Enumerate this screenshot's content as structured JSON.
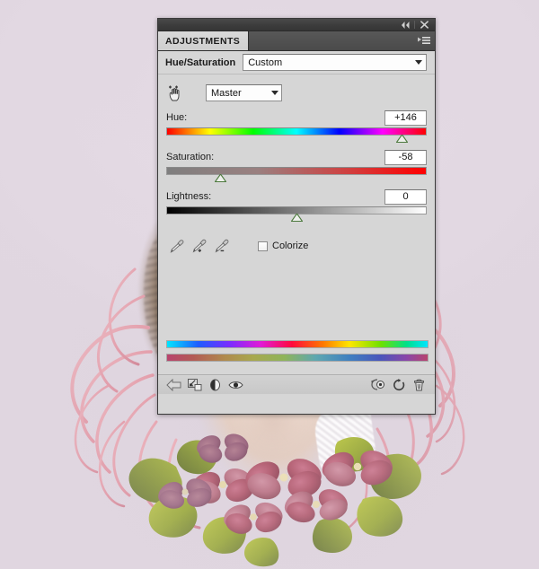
{
  "window": {
    "collapse_icon": "collapse-double-chevron-icon",
    "close_icon": "close-x-icon"
  },
  "panel": {
    "tab_label": "ADJUSTMENTS",
    "flyout_icon": "panel-menu-icon",
    "adjustment_name": "Hue/Saturation",
    "preset": {
      "value": "Custom",
      "dropdown_icon": "chevron-down-icon"
    },
    "target_tool_icon": "on-image-adjustment-hand-icon",
    "channel": {
      "value": "Master",
      "dropdown_icon": "chevron-down-icon"
    },
    "sliders": [
      {
        "name": "hue",
        "label": "Hue:",
        "value": "+146",
        "numeric": 146,
        "min": -180,
        "max": 180,
        "thumb_percent": 90.6
      },
      {
        "name": "saturation",
        "label": "Saturation:",
        "value": "-58",
        "numeric": -58,
        "min": -100,
        "max": 100,
        "thumb_percent": 21.0
      },
      {
        "name": "lightness",
        "label": "Lightness:",
        "value": "0",
        "numeric": 0,
        "min": -100,
        "max": 100,
        "thumb_percent": 50.0
      }
    ],
    "eyedroppers": [
      {
        "name": "sample-color-eyedropper",
        "icon": "eyedropper-icon"
      },
      {
        "name": "add-to-sample-eyedropper",
        "icon": "eyedropper-plus-icon"
      },
      {
        "name": "subtract-from-sample-eyedropper",
        "icon": "eyedropper-minus-icon"
      }
    ],
    "colorize": {
      "label": "Colorize",
      "checked": false
    },
    "spectrum": {
      "original_label": "original-hue-spectrum",
      "result_label": "adjusted-hue-spectrum"
    },
    "bottom_toolbar": [
      {
        "name": "return-to-adjustment-list-button",
        "icon": "left-arrow-icon"
      },
      {
        "name": "clip-to-layer-button",
        "icon": "clip-to-layer-icon"
      },
      {
        "name": "toggle-preset-button",
        "icon": "half-circle-icon"
      },
      {
        "name": "toggle-layer-visibility-button",
        "icon": "eye-icon"
      },
      {
        "name": "view-previous-state-button",
        "icon": "previous-state-icon"
      },
      {
        "name": "reset-adjustment-button",
        "icon": "reset-circular-arrow-icon"
      },
      {
        "name": "delete-adjustment-layer-button",
        "icon": "trash-icon"
      }
    ]
  },
  "colors": {
    "background": "#e0d6e0",
    "panel_bg": "#d6d6d6",
    "titlebar": "#3c3c3c",
    "tab_active": "#d4d4d4",
    "accent_red": "#ff0000",
    "thumb_green": "#6f9a5e",
    "flower_rose": "#b0566a",
    "leaf_olive": "#9aa830",
    "tendril_pink": "#e79aa6"
  }
}
